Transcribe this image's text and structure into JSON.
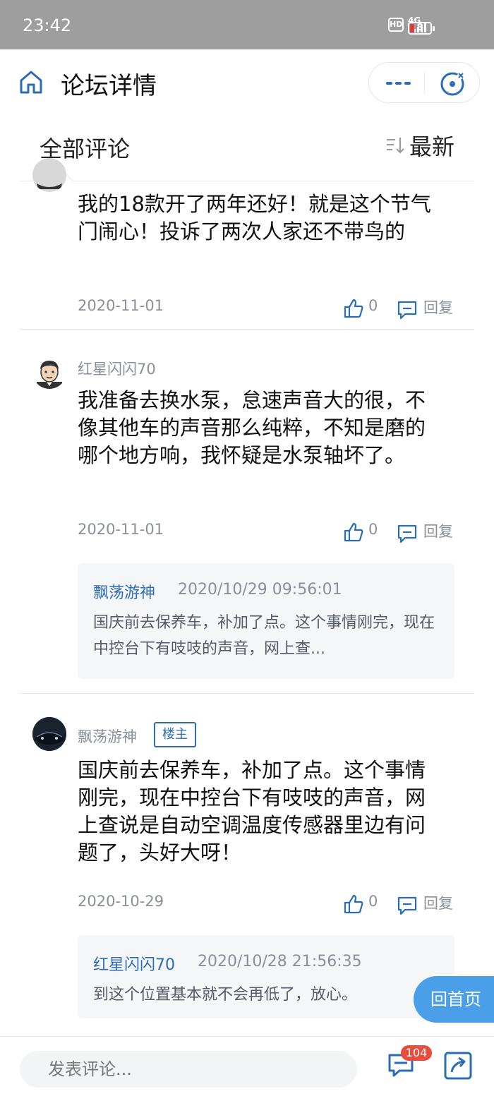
{
  "status_bar": {
    "time": "23:42",
    "hd": "HD",
    "network": "4G",
    "battery": "8"
  },
  "header": {
    "title": "论坛详情",
    "icons": {
      "home": "home-icon",
      "more": "more-dots-icon",
      "close": "close-target-icon"
    }
  },
  "section": {
    "title": "全部评论",
    "sort_label": "最新",
    "sort_icon": "sort-icon"
  },
  "comments": [
    {
      "username": "",
      "content": "我的18款开了两年还好！就是这个节气门闹心！投诉了两次人家还不带鸟的",
      "date": "2020-11-01",
      "likes": "0",
      "reply_label": "回复"
    },
    {
      "username": "红星闪闪70",
      "content": "我准备去换水泵，怠速声音大的很，不像其他车的声音那么纯粹，不知是磨的哪个地方响，我怀疑是水泵轴坏了。",
      "date": "2020-11-01",
      "likes": "0",
      "reply_label": "回复",
      "sub_reply": {
        "user": "飘荡游神",
        "time": "2020/10/29 09:56:01",
        "text": "国庆前去保养车，补加了点。这个事情刚完，现在中控台下有吱吱的声音，网上查..."
      }
    },
    {
      "username": "飘荡游神",
      "tag": "楼主",
      "content": "国庆前去保养车，补加了点。这个事情刚完，现在中控台下有吱吱的声音，网上查说是自动空调温度传感器里边有问题了，头好大呀！",
      "date": "2020-10-29",
      "likes": "0",
      "reply_label": "回复",
      "sub_reply": {
        "user": "红星闪闪70",
        "time": "2020/10/28 21:56:35",
        "text": "到这个位置基本就不会再低了，放心。"
      }
    }
  ],
  "fab": {
    "label": "回首页"
  },
  "bottom_bar": {
    "input_placeholder": "发表评论...",
    "comment_count": "104",
    "icons": {
      "comments": "comments-icon",
      "share": "share-icon"
    }
  },
  "colors": {
    "accent": "#2c6cb5",
    "fab": "#4a9fe8",
    "badge": "#e94b3c"
  }
}
